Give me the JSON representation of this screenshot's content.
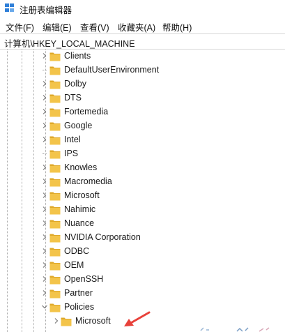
{
  "window": {
    "title": "注册表编辑器",
    "icon": "regedit-icon"
  },
  "menu": {
    "items": [
      {
        "label": "文件(F)"
      },
      {
        "label": "编辑(E)"
      },
      {
        "label": "查看(V)"
      },
      {
        "label": "收藏夹(A)"
      },
      {
        "label": "帮助(H)"
      }
    ]
  },
  "address": {
    "path": "计算机\\HKEY_LOCAL_MACHINE"
  },
  "tree": {
    "items": [
      {
        "label": "Clients",
        "expander": "collapsed"
      },
      {
        "label": "DefaultUserEnvironment",
        "expander": "none"
      },
      {
        "label": "Dolby",
        "expander": "collapsed"
      },
      {
        "label": "DTS",
        "expander": "collapsed"
      },
      {
        "label": "Fortemedia",
        "expander": "collapsed"
      },
      {
        "label": "Google",
        "expander": "collapsed"
      },
      {
        "label": "Intel",
        "expander": "collapsed"
      },
      {
        "label": "IPS",
        "expander": "none"
      },
      {
        "label": "Knowles",
        "expander": "collapsed"
      },
      {
        "label": "Macromedia",
        "expander": "collapsed"
      },
      {
        "label": "Microsoft",
        "expander": "collapsed"
      },
      {
        "label": "Nahimic",
        "expander": "collapsed"
      },
      {
        "label": "Nuance",
        "expander": "collapsed"
      },
      {
        "label": "NVIDIA Corporation",
        "expander": "collapsed"
      },
      {
        "label": "ODBC",
        "expander": "collapsed"
      },
      {
        "label": "OEM",
        "expander": "collapsed"
      },
      {
        "label": "OpenSSH",
        "expander": "collapsed"
      },
      {
        "label": "Partner",
        "expander": "collapsed"
      },
      {
        "label": "Policies",
        "expander": "expanded"
      },
      {
        "label": "Microsoft",
        "expander": "collapsed",
        "child": true
      }
    ]
  },
  "annotation": {
    "arrow_color": "#e8413a"
  },
  "colors": {
    "folder": "#f3c44a",
    "folder_dark": "#dfa92a",
    "chevron": "#7a7a7a"
  }
}
